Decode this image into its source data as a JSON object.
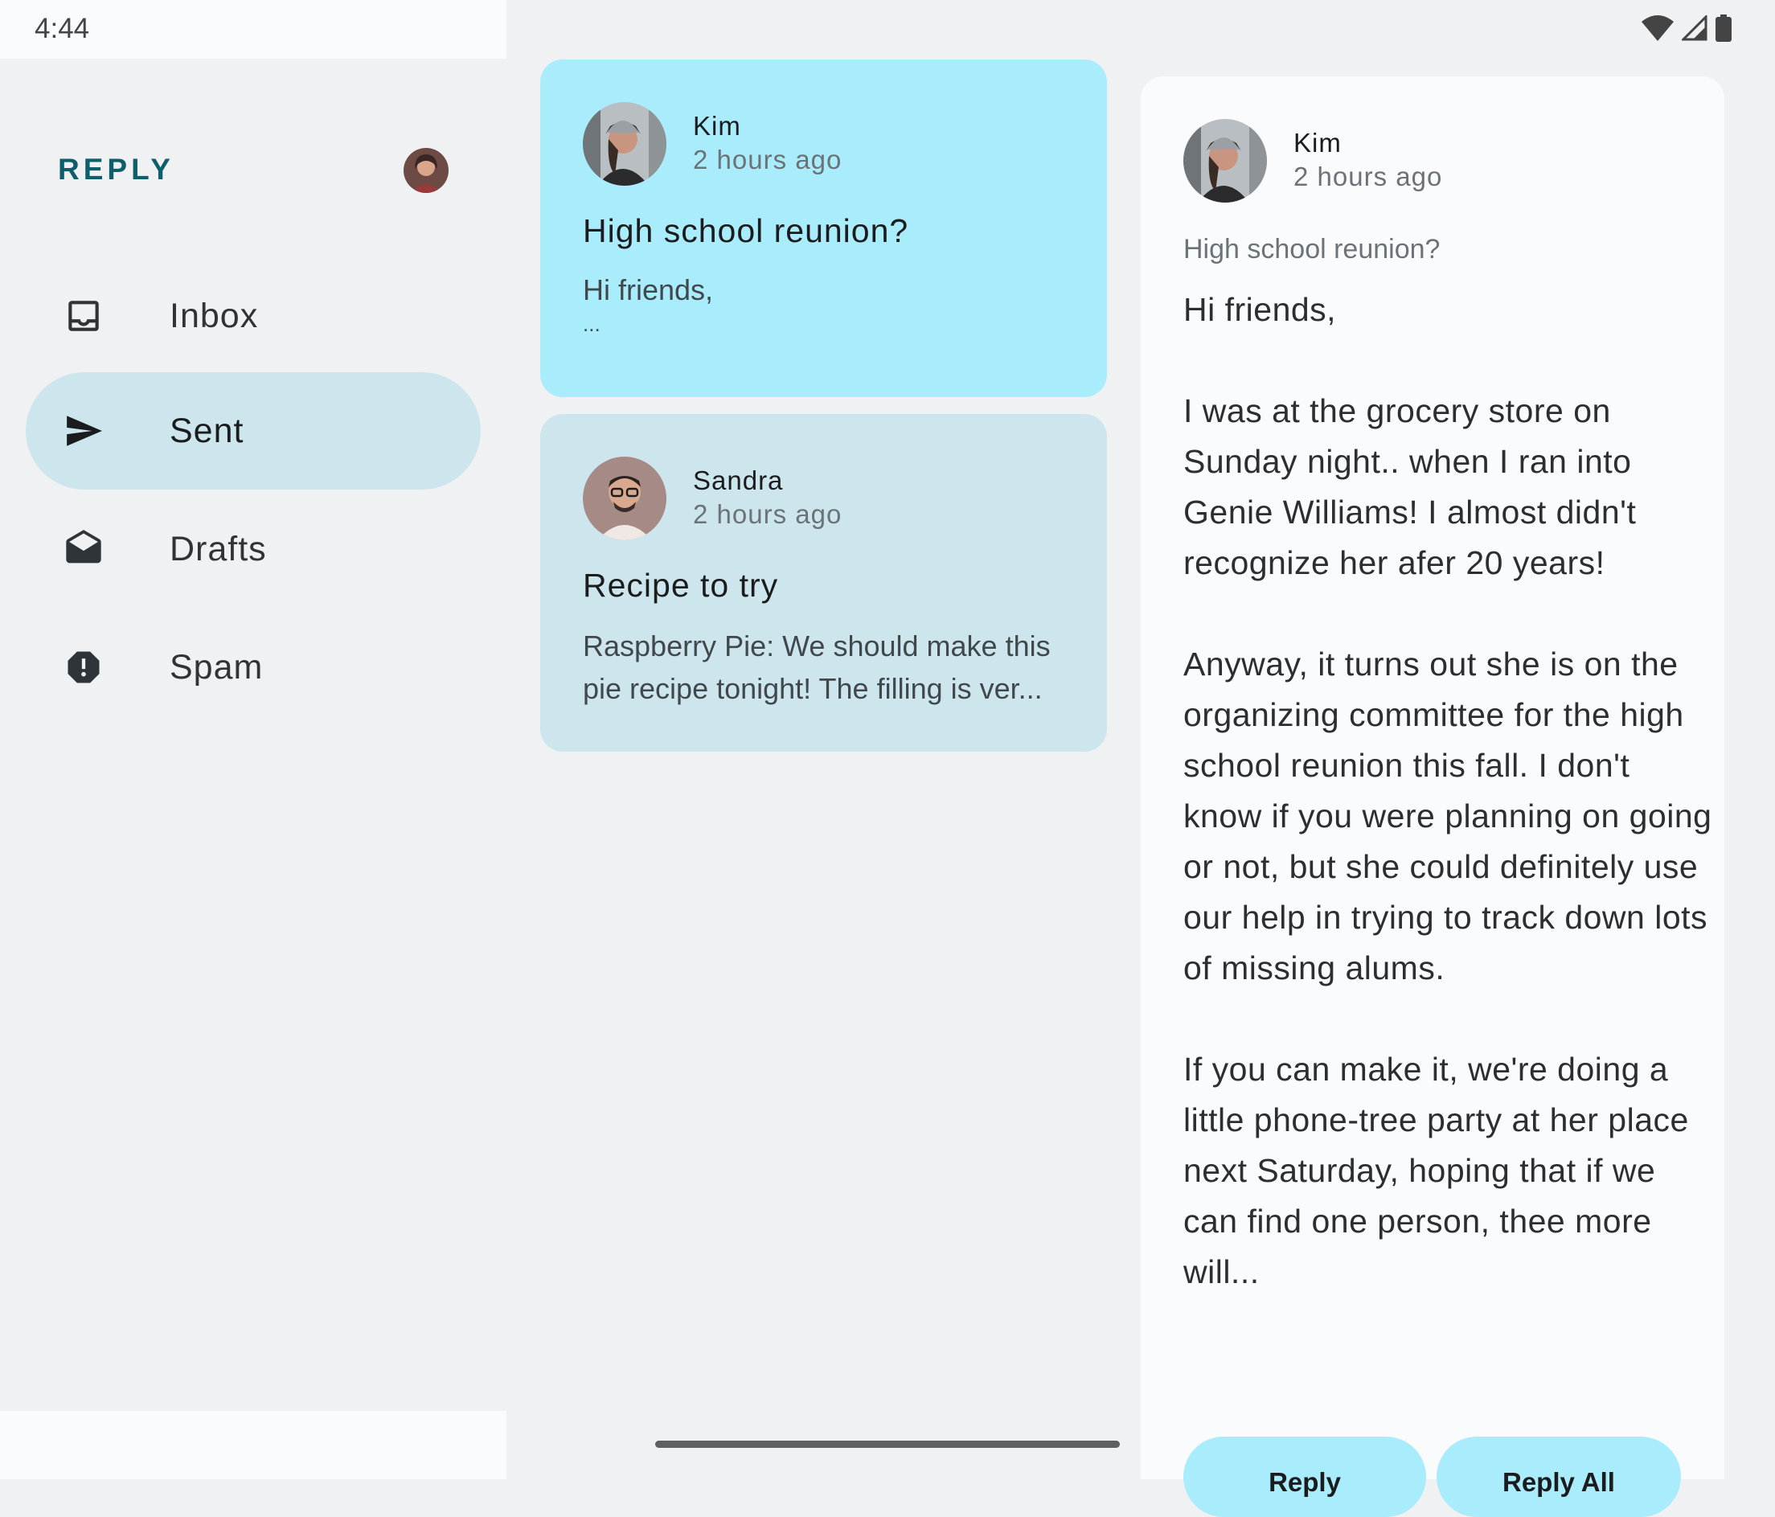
{
  "status_bar": {
    "time": "4:44"
  },
  "nav": {
    "logo": "REPLY",
    "items": [
      {
        "label": "Inbox",
        "icon": "inbox-icon",
        "active": false
      },
      {
        "label": "Sent",
        "icon": "send-icon",
        "active": true
      },
      {
        "label": "Drafts",
        "icon": "drafts-icon",
        "active": false
      },
      {
        "label": "Spam",
        "icon": "report-icon",
        "active": false
      }
    ]
  },
  "emails": [
    {
      "sender": "Kim",
      "time": "2 hours ago",
      "subject": "High school reunion?",
      "snippet_line1": "Hi friends,",
      "snippet_line2": "...",
      "selected": true
    },
    {
      "sender": "Sandra",
      "time": "2 hours ago",
      "subject": "Recipe to try",
      "snippet_line1": "Raspberry Pie: We should make this",
      "snippet_line2": "pie recipe tonight! The filling is ver..."
    }
  ],
  "detail": {
    "sender": "Kim",
    "time": "2 hours ago",
    "subject": "High school reunion?",
    "greeting": "Hi friends,",
    "para1": "I was at the grocery store on Sunday night.. when I ran into Genie Williams! I almost didn't recognize her afer 20 years!",
    "para2": "Anyway, it turns out she is on the organizing committee for the high school reunion this fall. I don't know if you were planning on going or not, but she could definitely use our help in trying to track down lots of missing alums.",
    "para3": "If you can make it, we're doing a little phone-tree party at her place next Saturday, hoping that if we can find one person, thee more will...",
    "reply_label": "Reply",
    "reply_all_label": "Reply All"
  },
  "colors": {
    "accent": "#0f5e6b",
    "selected_card": "#a9ecfb",
    "card": "#cde6ee",
    "nav_active": "#cde6ee"
  }
}
